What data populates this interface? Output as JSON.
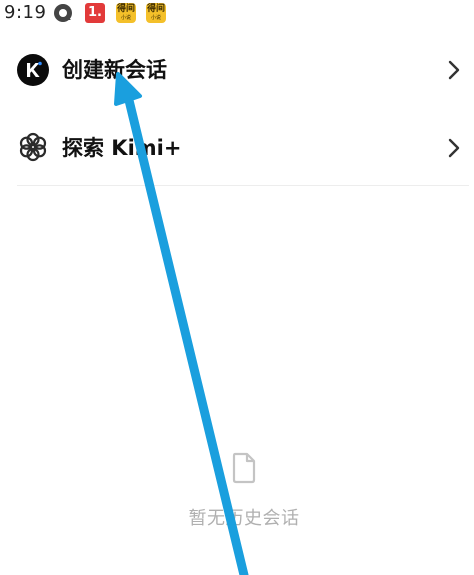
{
  "status_bar": {
    "time": "9:19",
    "apps": [
      {
        "icon": "camera-app-icon"
      },
      {
        "icon": "red-app-icon",
        "text": "1."
      },
      {
        "icon": "yellow-app-icon",
        "text": "得间",
        "subtext": "小说"
      },
      {
        "icon": "yellow-app-icon",
        "text": "得间",
        "subtext": "小说"
      }
    ]
  },
  "menu": {
    "new_chat": {
      "label": "创建新会话",
      "icon": "kimi-logo-icon"
    },
    "explore": {
      "label": "探索 Kimi+",
      "icon": "flower-icon"
    }
  },
  "empty_state": {
    "icon": "document-icon",
    "text": "暂无历史会话"
  },
  "colors": {
    "annotation_arrow": "#1a9fde",
    "red_app": "#e23a3a",
    "yellow_app": "#f4c02a",
    "empty_text": "#b0b0b0"
  }
}
